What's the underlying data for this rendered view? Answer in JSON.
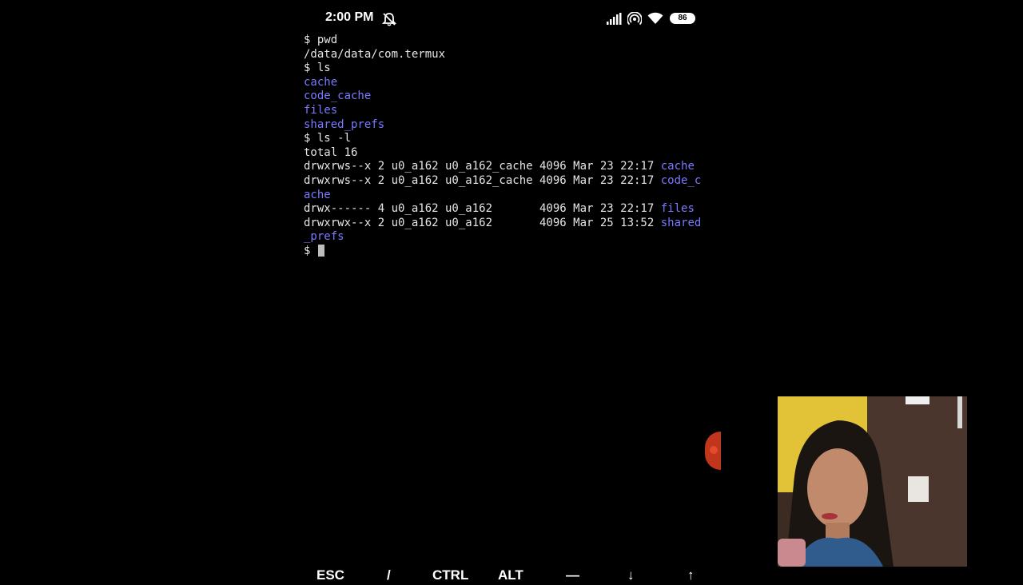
{
  "status_bar": {
    "time": "2:00 PM",
    "battery": "86",
    "icons": [
      "alarm-off-icon",
      "signal-icon",
      "hotspot-icon",
      "wifi-icon",
      "battery-icon"
    ]
  },
  "terminal": {
    "lines": [
      {
        "text": "$ pwd",
        "kind": "plain"
      },
      {
        "text": "/data/data/com.termux",
        "kind": "plain"
      },
      {
        "text": "$ ls",
        "kind": "plain"
      },
      {
        "text": "cache",
        "kind": "dir"
      },
      {
        "text": "code_cache",
        "kind": "dir"
      },
      {
        "text": "files",
        "kind": "dir"
      },
      {
        "text": "shared_prefs",
        "kind": "dir"
      },
      {
        "text": "$ ls -l",
        "kind": "plain"
      },
      {
        "text": "total 16",
        "kind": "plain"
      },
      {
        "prefix": "drwxrws--x 2 u0_a162 u0_a162_cache 4096 Mar 23 22:17 ",
        "name": "cache",
        "kind": "listing"
      },
      {
        "prefix": "drwxrws--x 2 u0_a162 u0_a162_cache 4096 Mar 23 22:17 ",
        "name": "code_c",
        "kind": "listing"
      },
      {
        "text": "ache",
        "kind": "dir"
      },
      {
        "prefix": "drwx------ 4 u0_a162 u0_a162       4096 Mar 23 22:17 ",
        "name": "files",
        "kind": "listing"
      },
      {
        "prefix": "drwxrwx--x 2 u0_a162 u0_a162       4096 Mar 25 13:52 ",
        "name": "shared",
        "kind": "listing"
      },
      {
        "text": "_prefs",
        "kind": "dir"
      }
    ],
    "prompt": "$ "
  },
  "extra_keys": {
    "esc": "ESC",
    "ctrl": "CTRL",
    "alt": "ALT"
  },
  "colors": {
    "background": "#000000",
    "text": "#e6e6e6",
    "directory": "#7a7aff"
  }
}
